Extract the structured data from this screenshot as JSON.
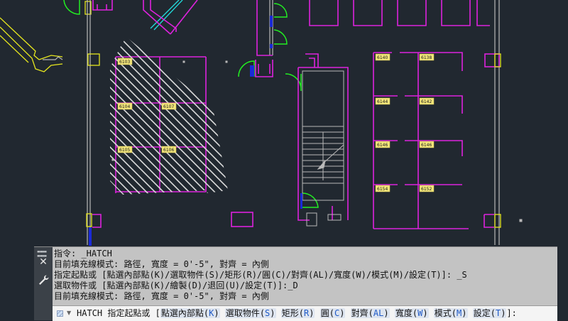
{
  "drawing": {
    "room_labels": {
      "r6103": "6103",
      "r6104": "6104",
      "r6107": "6107",
      "r6105": "6105",
      "r6106": "6106",
      "r6140": "6140",
      "r6138": "6138",
      "r6144": "6144",
      "r6142": "6142",
      "r6146a": "6146",
      "r6146b": "6146",
      "r6154": "6154",
      "r6152": "6152"
    }
  },
  "command_window": {
    "history": [
      "指令: _HATCH",
      "目前填充線模式: 路徑, 寬度 = 0'-5\", 對齊 = 內側",
      "指定起點或 [點選內部點(K)/選取物件(S)/矩形(R)/圓(C)/對齊(AL)/寬度(W)/模式(M)/設定(T)]: _S",
      "選取物件或 [點選內部點(K)/繪製(D)/退回(U)/設定(T)]:_D",
      "目前填充線模式: 路徑, 寬度 = 0'-5\", 對齊 = 內側"
    ],
    "prompt": {
      "command": "HATCH",
      "text": "指定起點或",
      "open_bracket": "[",
      "close": "]:",
      "options": [
        {
          "label": "點選內部點",
          "key": "K"
        },
        {
          "label": "選取物件",
          "key": "S"
        },
        {
          "label": "矩形",
          "key": "R"
        },
        {
          "label": "圓",
          "key": "C"
        },
        {
          "label": "對齊",
          "key": "AL"
        },
        {
          "label": "寬度",
          "key": "W"
        },
        {
          "label": "模式",
          "key": "M"
        },
        {
          "label": "設定",
          "key": "T"
        }
      ]
    },
    "icons": {
      "grip": "grip-dots-icon",
      "close": "close-icon",
      "customize": "wrench-icon",
      "hatch": "hatch-icon",
      "dropdown": "chevron-down-icon"
    }
  },
  "colors": {
    "background": "#212830",
    "walls": "#dd22dd",
    "wall_detail": "#b9b9b9",
    "doors": "#22ee22",
    "cyan": "#22dddd",
    "yellow": "#e6e61e",
    "blue": "#1a2ad8",
    "hatch": "#dcdcdc",
    "label_bg": "#f2e57a"
  }
}
